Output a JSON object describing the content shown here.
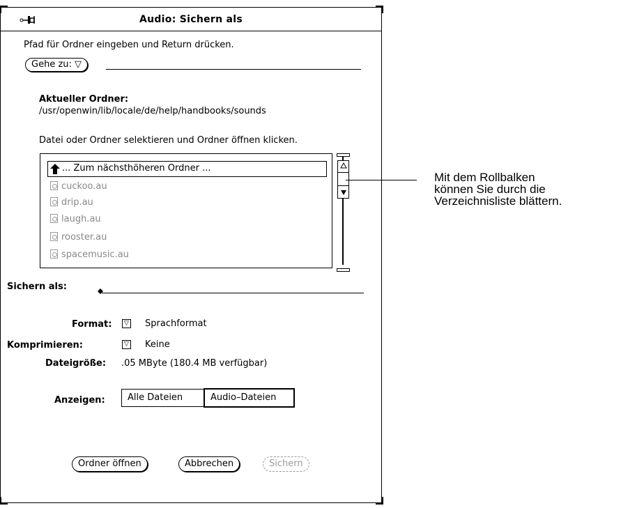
{
  "window": {
    "title": "Audio: Sichern als",
    "pushpin_icon": "pushpin-icon"
  },
  "path": {
    "instruction": "Pfad für Ordner eingeben und Return drücken.",
    "goto_label": "Gehe zu: ▽",
    "goto_value": ""
  },
  "current_folder": {
    "label": "Aktueller Ordner:",
    "value": "/usr/openwin/lib/locale/de/help/handbooks/sounds"
  },
  "list": {
    "instruction": "Datei oder Ordner selektieren und Ordner öffnen klicken.",
    "parent_item": "... Zum nächsthöheren Ordner ...",
    "files": [
      "cuckoo.au",
      "drip.au",
      "laugh.au",
      "rooster.au",
      "spacemusic.au"
    ]
  },
  "save_as": {
    "label": "Sichern als:",
    "value": ""
  },
  "format": {
    "label": "Format:",
    "value": "Sprachformat"
  },
  "compress": {
    "label": "Komprimieren:",
    "value": "Keine"
  },
  "filesize": {
    "label": "Dateigröße:",
    "value": ".05 MByte  (180.4 MB verfügbar)"
  },
  "show": {
    "label": "Anzeigen:",
    "options": [
      "Alle Dateien",
      "Audio–Dateien"
    ],
    "selected": "Audio–Dateien"
  },
  "buttons": {
    "open_folder": "Ordner öffnen",
    "cancel": "Abbrechen",
    "save": "Sichern"
  },
  "callout": {
    "text_lines": [
      "Mit dem Rollbalken",
      "können Sie durch die",
      "Verzeichnisliste blättern."
    ]
  }
}
